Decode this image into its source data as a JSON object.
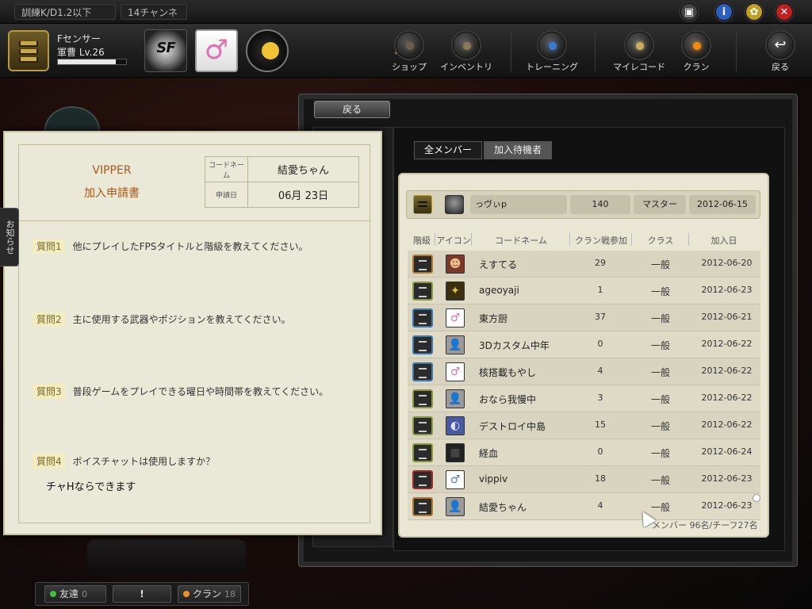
{
  "top": {
    "channel_filter": "訓練K/D1.2以下",
    "channel": "14チャンネル"
  },
  "user": {
    "name": "Fセンサー",
    "rank": "軍曹 Lv.26",
    "exp_fraction": 0.85
  },
  "logo_text": "SF",
  "nav": {
    "new_tag": "NEW",
    "items": [
      {
        "label": "ショップ",
        "color": "#6b5e4c"
      },
      {
        "label": "インベントリ",
        "color": "#8a7a5a"
      },
      {
        "label": "トレーニング",
        "color": "#3a7ad0"
      },
      {
        "label": "マイレコード",
        "color": "#c8b060"
      },
      {
        "label": "クラン",
        "color": "#f08a10"
      },
      {
        "label": "戻る",
        "color": "#ffffff"
      }
    ]
  },
  "notice_tab": "お知らせ",
  "form": {
    "clan_name": "VIPPER",
    "title": "加入申請書",
    "codename_key": "コードネーム",
    "codename_value": "結愛ちゃん",
    "date_key": "申請日",
    "date_value": "06月 23日",
    "questions": [
      {
        "num": "質問1",
        "text": "他にプレイしたFPSタイトルと階級を教えてください。"
      },
      {
        "num": "質問2",
        "text": "主に使用する武器やポジションを教えてください。"
      },
      {
        "num": "質問3",
        "text": "普段ゲームをプレイできる曜日や時間帯を教えてください。"
      },
      {
        "num": "質問4",
        "text": "ボイスチャットは使用しますか？"
      }
    ],
    "answer": "チャHならできます"
  },
  "clan_window": {
    "back_label": "戻る",
    "tabs": {
      "all": "全メンバー",
      "pending": "加入待機者"
    },
    "master": {
      "name": "っヴぃp",
      "participation": "140",
      "class": "マスター",
      "date": "2012-06-15"
    },
    "columns": {
      "rank": "階級",
      "icon": "アイコン",
      "name": "コードネーム",
      "participation": "クラン戦参加",
      "class": "クラス",
      "joined": "加入日"
    },
    "members": [
      {
        "name": "えすてる",
        "participation": "29",
        "class": "一般",
        "date": "2012-06-20",
        "rank_color": "#b07a2a",
        "avatar": "☻",
        "avatar_bg": "#7a3a2a",
        "avatar_fg": "#f0c090"
      },
      {
        "name": "ageoyaji",
        "participation": "1",
        "class": "一般",
        "date": "2012-06-23",
        "rank_color": "#8a9a40",
        "avatar": "✦",
        "avatar_bg": "#3a3010",
        "avatar_fg": "#e0c040"
      },
      {
        "name": "東方厨",
        "participation": "37",
        "class": "一般",
        "date": "2012-06-21",
        "rank_color": "#3a7ab0",
        "avatar": "♂",
        "avatar_bg": "#ffffff",
        "avatar_fg": "#e070b0"
      },
      {
        "name": "3Dカスタム中年",
        "participation": "0",
        "class": "一般",
        "date": "2012-06-22",
        "rank_color": "#3a7ab0",
        "avatar": "👤",
        "avatar_bg": "#9a9a9a",
        "avatar_fg": "#444"
      },
      {
        "name": "核搭載もやし",
        "participation": "4",
        "class": "一般",
        "date": "2012-06-22",
        "rank_color": "#3a7ab0",
        "avatar": "♂",
        "avatar_bg": "#ffffff",
        "avatar_fg": "#e070b0"
      },
      {
        "name": "おなら我慢中",
        "participation": "3",
        "class": "一般",
        "date": "2012-06-22",
        "rank_color": "#8a9a40",
        "avatar": "👤",
        "avatar_bg": "#9a9a9a",
        "avatar_fg": "#444"
      },
      {
        "name": "デストロイ中島",
        "participation": "15",
        "class": "一般",
        "date": "2012-06-22",
        "rank_color": "#8a9a40",
        "avatar": "◐",
        "avatar_bg": "#4a5aa0",
        "avatar_fg": "#dde"
      },
      {
        "name": "経血",
        "participation": "0",
        "class": "一般",
        "date": "2012-06-24",
        "rank_color": "#8a9a40",
        "avatar": "■",
        "avatar_bg": "#222",
        "avatar_fg": "#444"
      },
      {
        "name": "vippiv",
        "participation": "18",
        "class": "一般",
        "date": "2012-06-23",
        "rank_color": "#a02a2a",
        "avatar": "♂",
        "avatar_bg": "#ffffff",
        "avatar_fg": "#5080c0"
      },
      {
        "name": "結愛ちゃん",
        "participation": "4",
        "class": "一般",
        "date": "2012-06-23",
        "rank_color": "#b07a2a",
        "avatar": "👤",
        "avatar_bg": "#9a9a9a",
        "avatar_fg": "#444"
      }
    ],
    "member_count": "メンバー 96名/チーフ27名"
  },
  "bottom": {
    "friends_label": "友達",
    "friends_count": "0",
    "alert_label": "!",
    "clan_label": "クラン",
    "clan_count": "18"
  },
  "colors": {
    "accent_orange": "#f08a10",
    "form_title": "#a8581e",
    "friends_dot": "#40c040",
    "clan_dot": "#f09020"
  }
}
